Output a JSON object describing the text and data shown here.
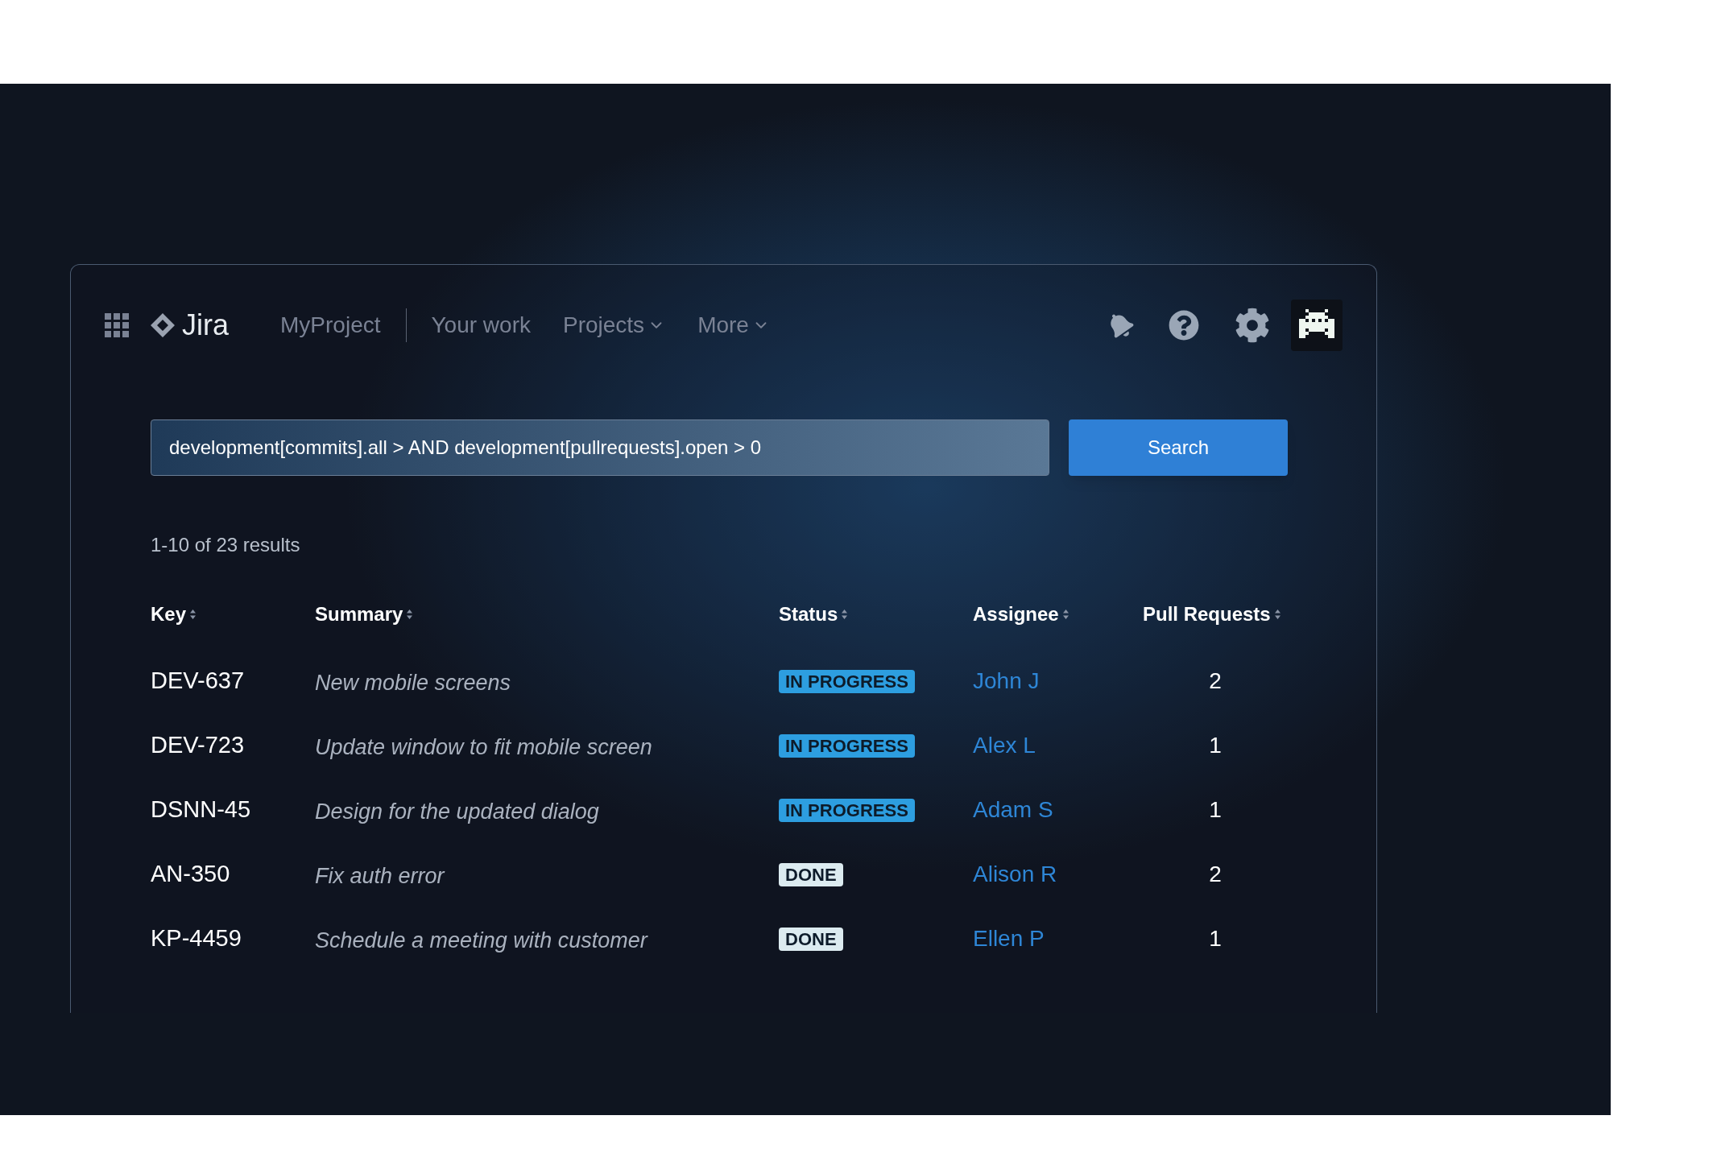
{
  "nav": {
    "logo": "Jira",
    "project": "MyProject",
    "items": [
      {
        "label": "Your work",
        "dropdown": false
      },
      {
        "label": "Projects",
        "dropdown": true
      },
      {
        "label": "More",
        "dropdown": true
      }
    ]
  },
  "search": {
    "value": "development[commits].all > AND development[pullrequests].open > 0",
    "button": "Search"
  },
  "results": "1-10 of 23 results",
  "table": {
    "columns": [
      "Key",
      "Summary",
      "Status",
      "Assignee",
      "Pull Requests"
    ],
    "rows": [
      {
        "key": "DEV-637",
        "summary": "New mobile screens",
        "status": {
          "label": "IN PROGRESS",
          "kind": "progress"
        },
        "assignee": "John J",
        "pull_requests": "2"
      },
      {
        "key": "DEV-723",
        "summary": "Update window to fit mobile screen",
        "status": {
          "label": "IN PROGRESS",
          "kind": "progress"
        },
        "assignee": "Alex L",
        "pull_requests": "1"
      },
      {
        "key": "DSNN-45",
        "summary": "Design for the updated dialog",
        "status": {
          "label": "IN PROGRESS",
          "kind": "progress"
        },
        "assignee": "Adam S",
        "pull_requests": "1"
      },
      {
        "key": "AN-350",
        "summary": "Fix auth error",
        "status": {
          "label": "DONE",
          "kind": "done"
        },
        "assignee": "Alison R",
        "pull_requests": "2"
      },
      {
        "key": "KP-4459",
        "summary": "Schedule a meeting with customer",
        "status": {
          "label": "DONE",
          "kind": "done"
        },
        "assignee": "Ellen P",
        "pull_requests": "1"
      }
    ]
  }
}
